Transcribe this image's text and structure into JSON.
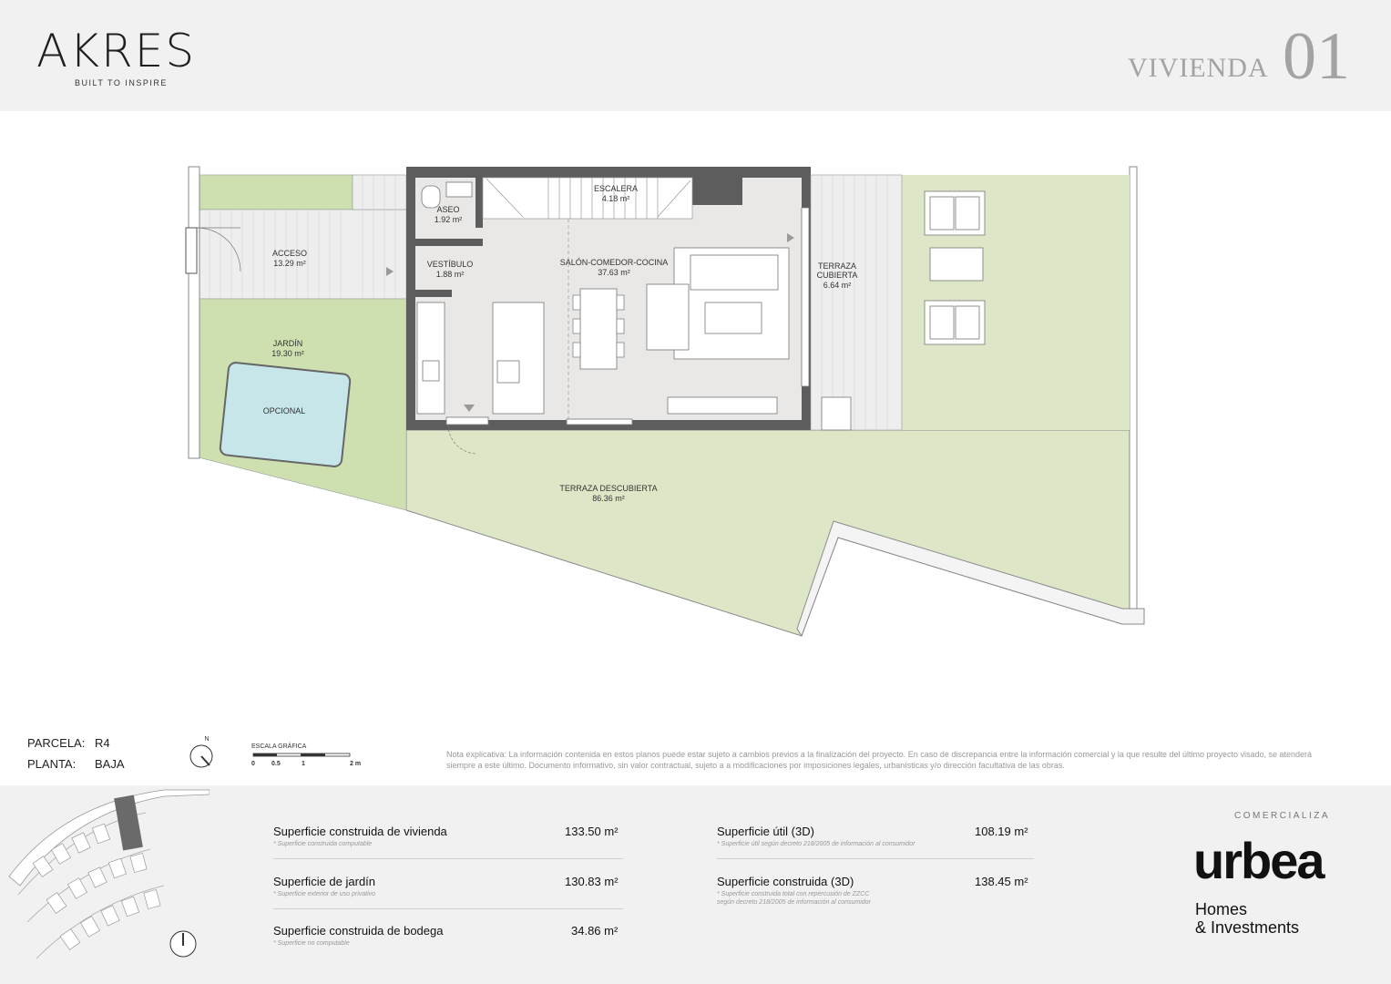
{
  "header": {
    "logo_text": "AKRES",
    "logo_tagline": "BUILT TO INSPIRE",
    "unit_label": "VIVIENDA",
    "unit_number": "01"
  },
  "plan": {
    "rooms": {
      "acceso": {
        "name": "ACCESO",
        "area": "13.29 m²"
      },
      "aseo": {
        "name": "ASEO",
        "area": "1.92 m²"
      },
      "escalera": {
        "name": "ESCALERA",
        "area": "4.18 m²"
      },
      "vestibulo": {
        "name": "VESTÍBULO",
        "area": "1.88 m²"
      },
      "salon": {
        "name": "SALÓN-COMEDOR-COCINA",
        "area": "37.63 m²"
      },
      "terraza_cubierta": {
        "name_line1": "TERRAZA",
        "name_line2": "CUBIERTA",
        "area": "6.64 m²"
      },
      "jardin": {
        "name": "JARDÍN",
        "area": "19.30 m²"
      },
      "piscina": {
        "name": "OPCIONAL"
      },
      "terraza_descubierta": {
        "name": "TERRAZA DESCUBIERTA",
        "area": "86.36 m²"
      }
    },
    "colors": {
      "garden": "#d5e4b8",
      "garden_light": "#dde9c7",
      "interior": "#e9e8e6",
      "wall": "#5a5a5a",
      "deck": "#ececec",
      "pool": "#c7e6ea"
    }
  },
  "info": {
    "parcela_label": "PARCELA:",
    "parcela_value": "R4",
    "planta_label": "PLANTA:",
    "planta_value": "BAJA",
    "north_label": "N",
    "scale_title": "ESCALA GRÁFICA",
    "scale_ticks": [
      "0",
      "0.5",
      "1",
      "2 m"
    ],
    "note": "Nota explicativa: La información contenida en estos planos puede estar sujeto a cambios previos a la finalización del proyecto. En caso de discrepancia entre la información comercial y la que resulte del último proyecto visado, se atenderá siempre a este último. Documento informativo, sin valor contractual, sujeto a a modificaciones por imposiciones legales, urbanísticas y/o dirección facultativa de las obras."
  },
  "surfaces": {
    "left": [
      {
        "label": "Superficie construida de vivienda",
        "value": "133.50 m²",
        "note": "* Superficie construida computable"
      },
      {
        "label": "Superficie de jardín",
        "value": "130.83 m²",
        "note": "* Superficie exterior de uso privativo"
      },
      {
        "label": "Superficie construida de bodega",
        "value": "34.86 m²",
        "note": "* Superficie no computable"
      }
    ],
    "right": [
      {
        "label": "Superficie útil (3D)",
        "value": "108.19 m²",
        "note": "* Superficie útil según decreto 218/2005 de información al consumidor"
      },
      {
        "label": "Superficie construida (3D)",
        "value": "138.45 m²",
        "note": "* Superficie construida total con repercusión de ZZCC",
        "note2": "según decreto 218/2005 de información al consumidor"
      }
    ]
  },
  "brand": {
    "comercializa": "COMERCIALIZA",
    "name": "urbea",
    "tagline1": "Homes",
    "tagline2": "& Investments"
  }
}
